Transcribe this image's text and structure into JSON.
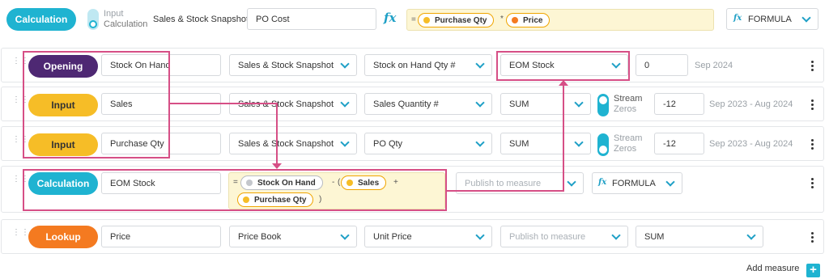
{
  "top": {
    "type_label": "Calculation",
    "input_calc_line1": "Input",
    "input_calc_line2": "Calculation",
    "dataset": "Sales & Stock Snapshot",
    "measure_name": "PO Cost",
    "formula": {
      "prefix": "=",
      "token1": "Purchase Qty",
      "operator": "*",
      "token2": "Price"
    },
    "method": "FORMULA"
  },
  "rows": [
    {
      "type": "Opening",
      "name": "Stock On Hand",
      "dataset": "Sales & Stock Snapshot",
      "field": "Stock on Hand Qty #",
      "agg": "EOM Stock",
      "offset": "0",
      "period": "Sep 2024"
    },
    {
      "type": "Input",
      "name": "Sales",
      "dataset": "Sales & Stock Snapshot",
      "field": "Sales Quantity #",
      "agg": "SUM",
      "stream1": "Stream",
      "stream2": "Zeros",
      "offset": "-12",
      "period": "Sep 2023 - Aug 2024"
    },
    {
      "type": "Input",
      "name": "Purchase Qty",
      "dataset": "Sales & Stock Snapshot",
      "field": "PO Qty",
      "agg": "SUM",
      "stream1": "Stream",
      "stream2": "Zeros",
      "offset": "-12",
      "period": "Sep 2023 - Aug 2024"
    },
    {
      "type": "Calculation",
      "name": "EOM Stock",
      "formula": {
        "prefix": "=",
        "token1": "Stock On Hand",
        "op1": "-",
        "paren_open": "(",
        "token2": "Sales",
        "op2": "+",
        "token3": "Purchase Qty",
        "paren_close": ")"
      },
      "publish_placeholder": "Publish to measure",
      "method": "FORMULA"
    },
    {
      "type": "Lookup",
      "name": "Price",
      "dataset": "Price Book",
      "field": "Unit Price",
      "publish_placeholder": "Publish to measure",
      "agg": "SUM"
    }
  ],
  "footer": {
    "add_measure": "Add measure",
    "add_symbol": "+"
  },
  "icons": {
    "fx": "fx",
    "drag": "drag-handle-icon",
    "menu": "kebab-menu-icon",
    "chevron": "chevron-down-icon"
  },
  "colors": {
    "calculation": "#1fb3d1",
    "opening": "#4e2873",
    "input": "#f6bd27",
    "lookup": "#f47a20",
    "highlight": "#d64f86"
  }
}
